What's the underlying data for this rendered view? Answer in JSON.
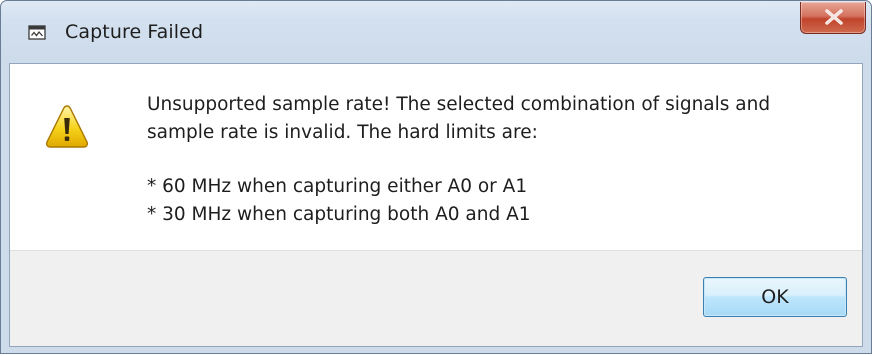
{
  "window": {
    "title": "Capture Failed",
    "title_icon": "app-window-icon",
    "close_icon": "close-x-icon",
    "accent_close_color": "#c7492f"
  },
  "dialog": {
    "icon": "warning-triangle-icon",
    "message_line1": "Unsupported sample rate! The selected combination of signals and",
    "message_line2": "sample rate is invalid. The hard limits are:",
    "limit1": "* 60 MHz when capturing either A0 or A1",
    "limit2": "* 30 MHz when capturing both A0 and A1"
  },
  "buttons": {
    "ok_label": "OK"
  }
}
